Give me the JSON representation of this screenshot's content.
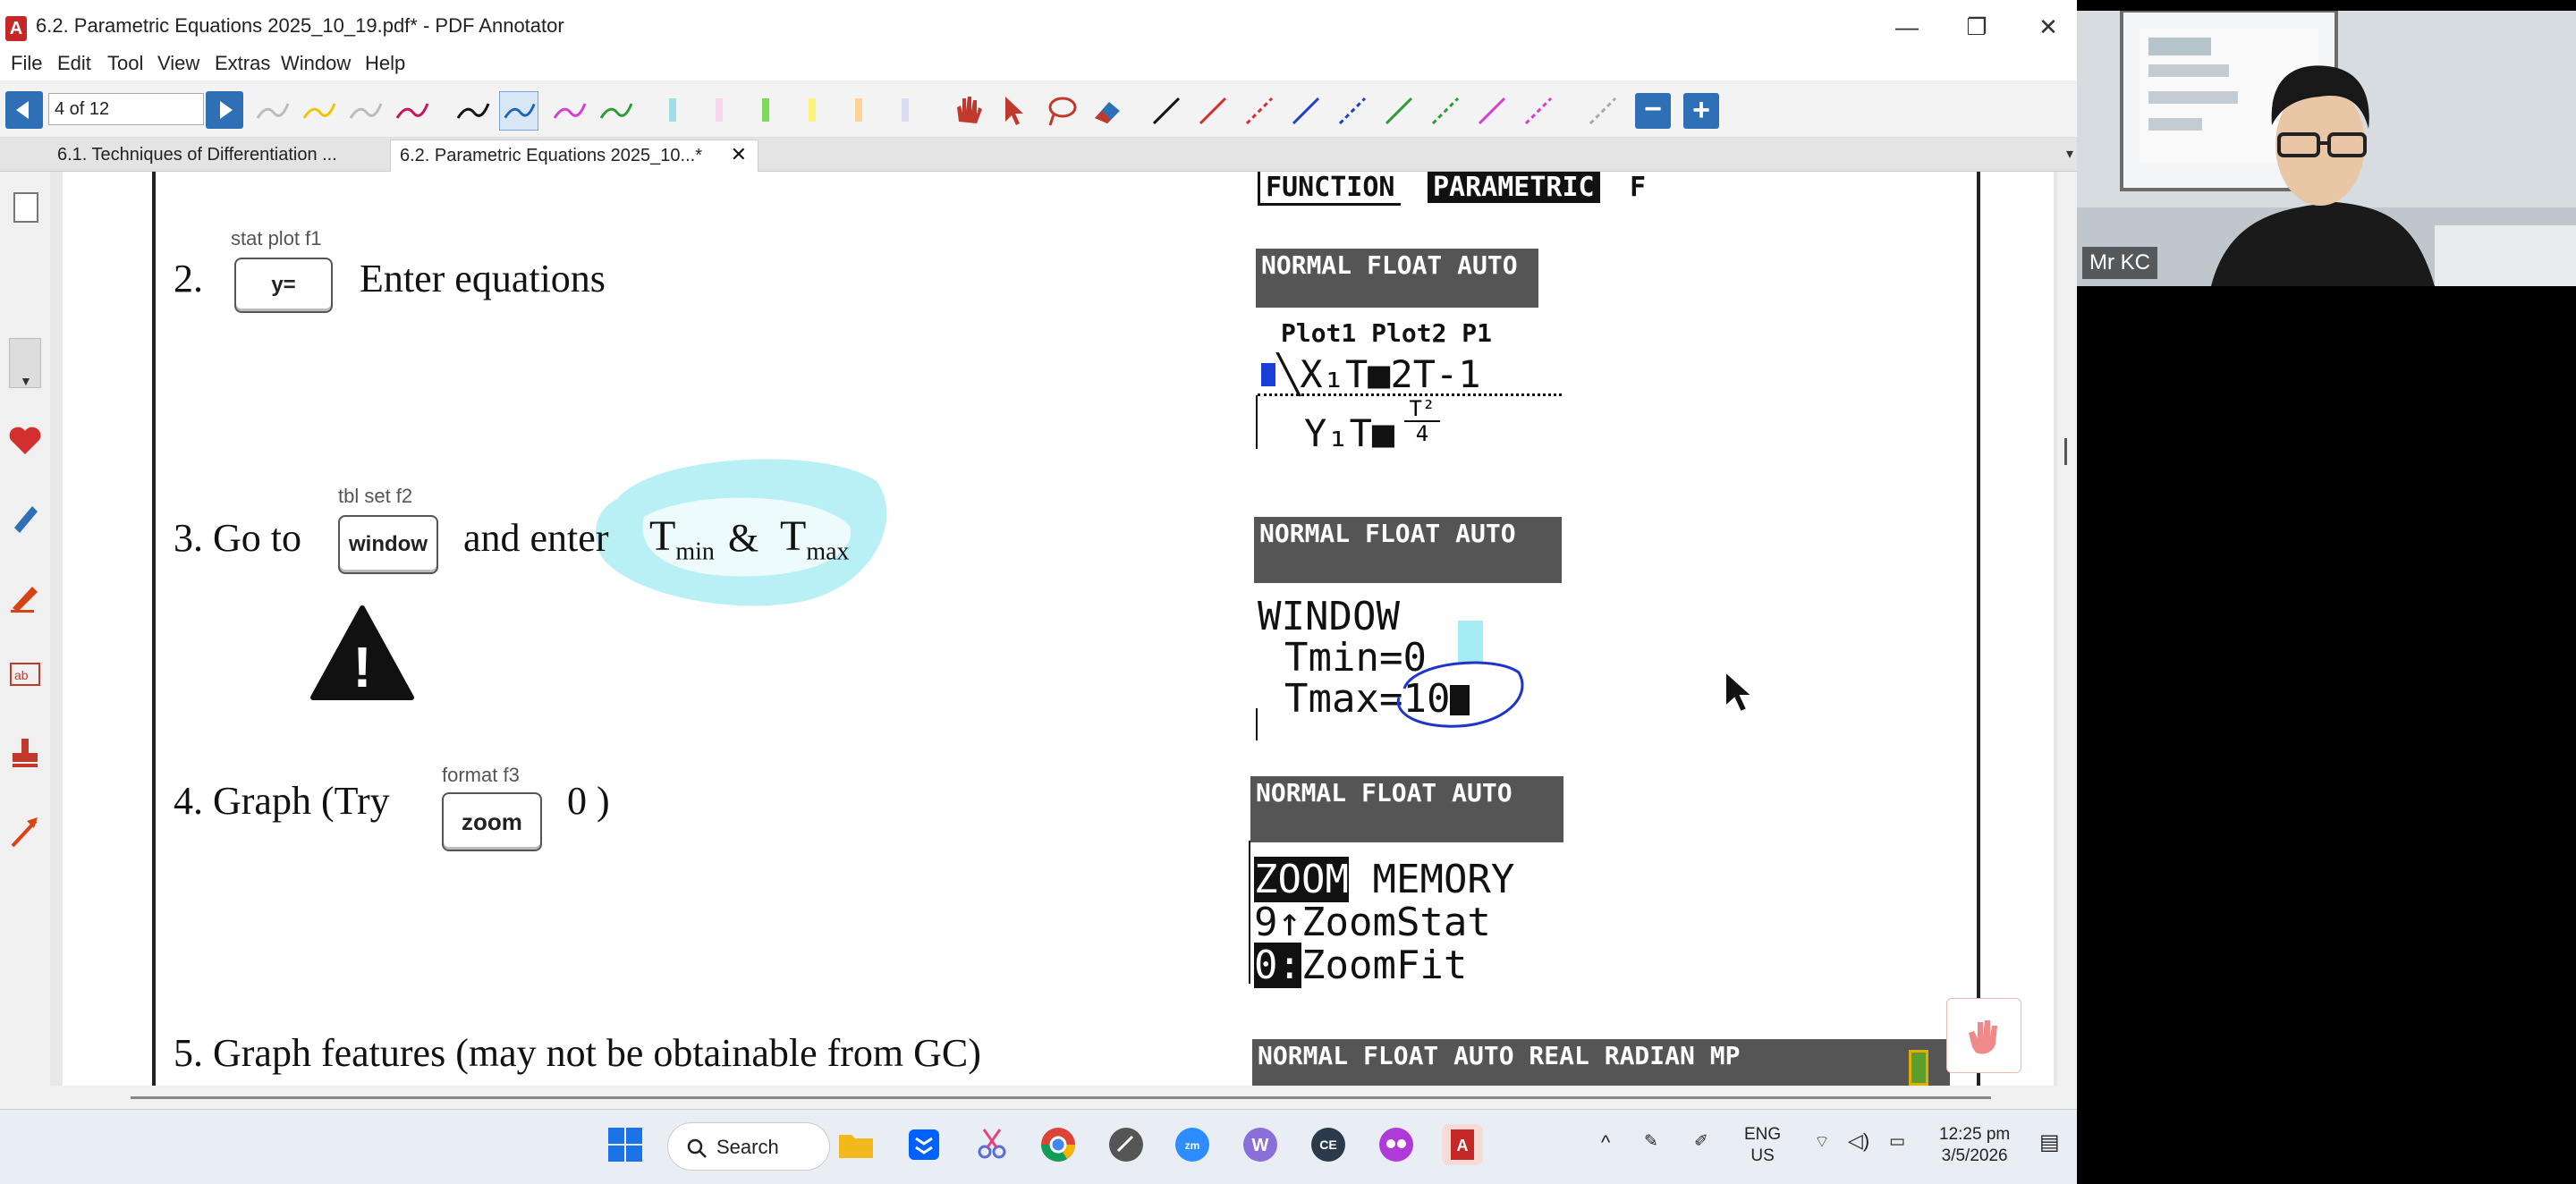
{
  "window": {
    "title": "6.2. Parametric Equations 2025_10_19.pdf* - PDF Annotator",
    "minimize": "—",
    "maximize": "❐",
    "close": "✕"
  },
  "menu": [
    "File",
    "Edit",
    "Tool",
    "View",
    "Extras",
    "Window",
    "Help"
  ],
  "toolbar": {
    "page_value": "4 of 12"
  },
  "tabs": [
    {
      "label": "6.1. Techniques of Differentiation ..."
    },
    {
      "label": "6.2. Parametric Equations 2025_10...*",
      "close": "✕"
    }
  ],
  "page": {
    "step2": {
      "number": "2.",
      "key_top": "stat plot  f1",
      "key": "y=",
      "text": "Enter equations"
    },
    "step3": {
      "prefix": "3. Go to",
      "key_top": "tbl set   f2",
      "key": "window",
      "mid": "and enter",
      "t1": "T",
      "t1_sub": "min",
      "amp": "&",
      "t2": "T",
      "t2_sub": "max"
    },
    "warning_icon": "!",
    "step4": {
      "prefix": "4. Graph (Try",
      "key_top": "format  f3",
      "key": "zoom",
      "suffix": "0 )"
    },
    "step5": {
      "text": "5. Graph features (may not be obtainable from GC)"
    },
    "calc_mode": {
      "function": "FUNCTION",
      "parametric": "PARAMETRIC",
      "trail": "F"
    },
    "calc1": {
      "header": "NORMAL FLOAT AUTO",
      "tabs": "Plot1  Plot2  P1",
      "x_line": "X₁T■2T-1",
      "y_line": "Y₁T■",
      "y_num": "T²",
      "y_den": "4"
    },
    "calc2": {
      "header": "NORMAL FLOAT AUTO",
      "title": "WINDOW",
      "tmin": "Tmin=0",
      "tmax": "Tmax=10"
    },
    "calc3": {
      "header": "NORMAL FLOAT AUTO",
      "zoom": "ZOOM",
      "memory": "MEMORY",
      "line1": "9↑ZoomStat",
      "line2_key": "0:",
      "line2": "ZoomFit"
    },
    "calc4": {
      "header": "NORMAL FLOAT AUTO REAL RADIAN MP"
    }
  },
  "webcam": {
    "name": "Mr KC"
  },
  "taskbar": {
    "search": "Search",
    "lang_top": "ENG",
    "lang_bottom": "US",
    "time": "12:25 pm",
    "date": "3/5/2026"
  },
  "colors": {
    "nav_blue": "#2f6fb5",
    "highlight_cyan": "#7fe3ef",
    "pen_blue": "#1e35c8",
    "calc_header": "#555555"
  }
}
